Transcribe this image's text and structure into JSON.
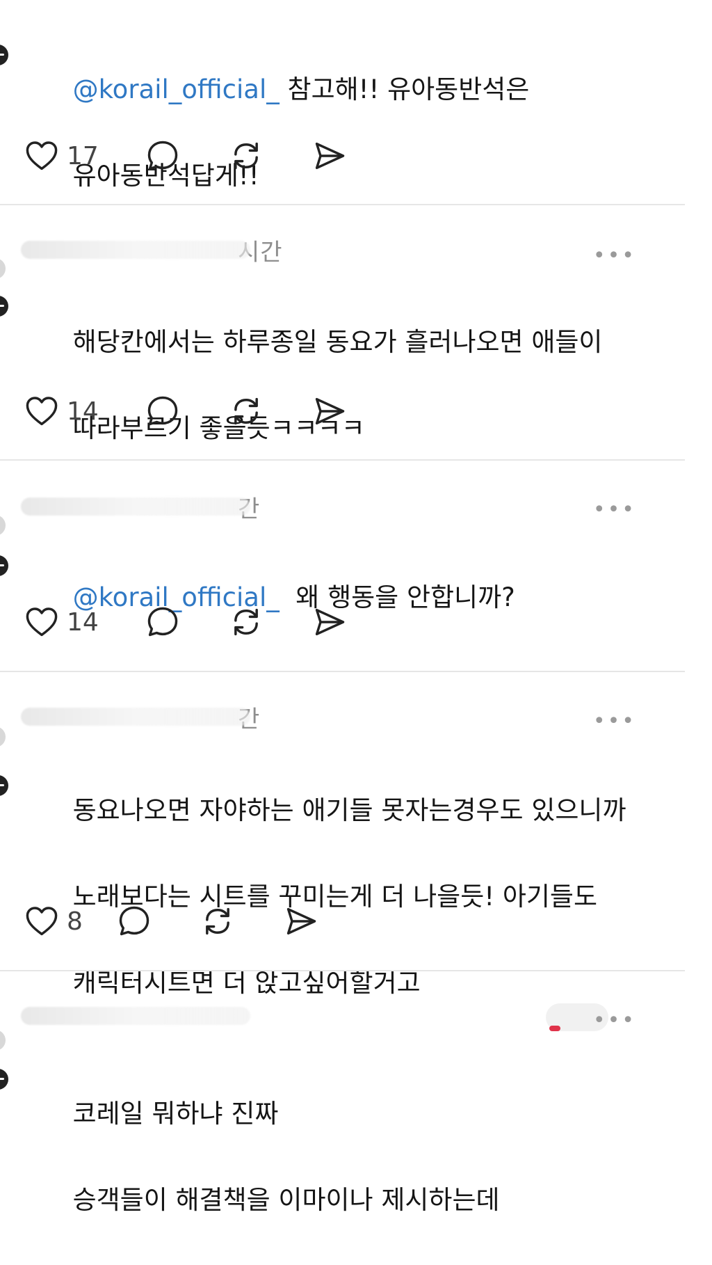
{
  "posts": [
    {
      "mention": "@korail_official_",
      "text_line1": " 참고해!! 유아동반석은",
      "text_line2": "유아동반석답게!!",
      "likes": "17"
    },
    {
      "time": "시간",
      "text_line1": "해당칸에서는 하루종일 동요가 흘러나오면 애들이",
      "text_line2": "따라부르기 좋을듯ㅋㅋㅋㅋ",
      "likes": "14"
    },
    {
      "time": "간",
      "mention": "@korail_official_",
      "text_line1": "  왜 행동을 안합니까?",
      "likes": "14"
    },
    {
      "time": "간",
      "text_line1": "동요나오면 자야하는 애기들 못자는경우도 있으니까",
      "text_line2": "노래보다는 시트를 꾸미는게 더 나을듯! 아기들도",
      "text_line3": "캐릭터시트면 더 앉고싶어할거고",
      "likes": "8"
    },
    {
      "time": "",
      "text_line1": "코레일 뭐하냐 진짜",
      "text_line2": "승객들이 해결책을 이마이나 제시하는데"
    }
  ],
  "more_label": "•••",
  "icons": {
    "like": "heart-icon",
    "reply": "comment-icon",
    "repost": "repost-icon",
    "share": "send-icon"
  },
  "colors": {
    "mention": "#2f78c4",
    "text": "#151515",
    "muted": "#8e8e8e",
    "divider": "#e6e6e6"
  }
}
